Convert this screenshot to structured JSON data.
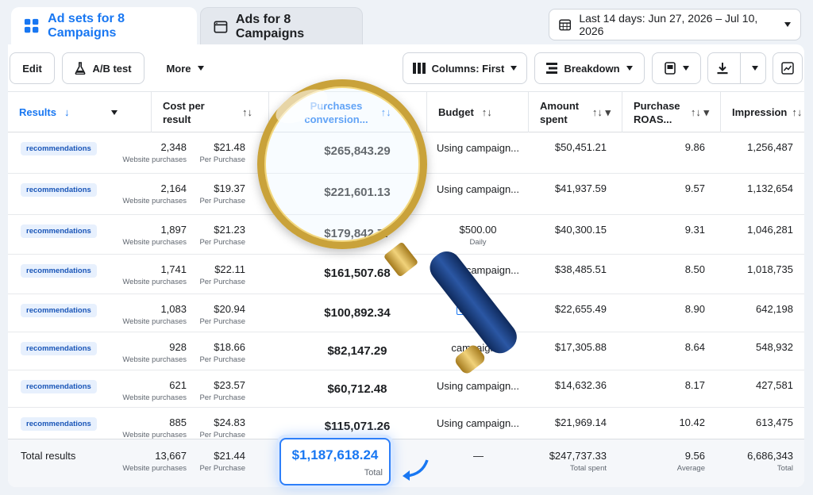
{
  "tabs": {
    "adsets": "Ad sets for 8 Campaigns",
    "ads": "Ads for 8 Campaigns"
  },
  "date_range": "Last 14 days: Jun 27, 2026 – Jul 10, 2026",
  "toolbar": {
    "edit": "Edit",
    "ab_test": "A/B test",
    "more": "More",
    "columns": "Columns: First",
    "breakdown": "Breakdown"
  },
  "columns": {
    "results": "Results",
    "cost_line1": "Cost per",
    "cost_line2": "result",
    "purch_line1": "Purchases",
    "purch_line2": "conversion...",
    "budget": "Budget",
    "amount_line1": "Amount",
    "amount_line2": "spent",
    "roas_line1": "Purchase",
    "roas_line2": "ROAS...",
    "impressions": "Impression"
  },
  "rows": [
    {
      "badge": "recommendations",
      "results": "2,348",
      "results_sub": "Website purchases",
      "cost": "$21.48",
      "cost_sub": "Per Purchase",
      "purchases": "$265,843.29",
      "budget": "Using campaign...",
      "budget_sub": "",
      "amount": "$50,451.21",
      "roas": "9.86",
      "impressions": "1,256,487"
    },
    {
      "badge": "recommendations",
      "results": "2,164",
      "results_sub": "Website purchases",
      "cost": "$19.37",
      "cost_sub": "Per Purchase",
      "purchases": "$221,601.13",
      "budget": "Using campaign...",
      "budget_sub": "",
      "amount": "$41,937.59",
      "roas": "9.57",
      "impressions": "1,132,654"
    },
    {
      "badge": "recommendations",
      "results": "1,897",
      "results_sub": "Website purchases",
      "cost": "$21.23",
      "cost_sub": "Per Purchase",
      "purchases": "$179,842.77",
      "budget": "$500.00",
      "budget_sub": "Daily",
      "amount": "$40,300.15",
      "roas": "9.31",
      "impressions": "1,046,281"
    },
    {
      "badge": "recommendations",
      "results": "1,741",
      "results_sub": "Website purchases",
      "cost": "$22.11",
      "cost_sub": "Per Purchase",
      "purchases": "$161,507.68",
      "budget": "Using campaign...",
      "budget_sub": "",
      "amount": "$38,485.51",
      "roas": "8.50",
      "impressions": "1,018,735"
    },
    {
      "badge": "recommendations",
      "results": "1,083",
      "results_sub": "Website purchases",
      "cost": "$20.94",
      "cost_sub": "Per Purchase",
      "purchases": "$100,892.34",
      "budget": "$150.00",
      "budget_sub": "Daily",
      "amount": "$22,655.49",
      "roas": "8.90",
      "impressions": "642,198"
    },
    {
      "badge": "recommendations",
      "results": "928",
      "results_sub": "Website purchases",
      "cost": "$18.66",
      "cost_sub": "Per Purchase",
      "purchases": "$82,147.29",
      "budget": "campaign...",
      "budget_sub": "",
      "amount": "$17,305.88",
      "roas": "8.64",
      "impressions": "548,932"
    },
    {
      "badge": "recommendations",
      "results": "621",
      "results_sub": "Website purchases",
      "cost": "$23.57",
      "cost_sub": "Per Purchase",
      "purchases": "$60,712.48",
      "budget": "Using campaign...",
      "budget_sub": "",
      "amount": "$14,632.36",
      "roas": "8.17",
      "impressions": "427,581"
    },
    {
      "badge": "recommendations",
      "results": "885",
      "results_sub": "Website purchases",
      "cost": "$24.83",
      "cost_sub": "Per Purchase",
      "purchases": "$115,071.26",
      "budget": "Using campaign...",
      "budget_sub": "",
      "amount": "$21,969.14",
      "roas": "10.42",
      "impressions": "613,475"
    }
  ],
  "totals": {
    "label": "Total results",
    "results": "13,667",
    "results_sub": "Website purchases",
    "cost": "$21.44",
    "cost_sub": "Per Purchase",
    "purchases": "$1,187,618.24",
    "purchases_sub": "Total",
    "budget": "—",
    "amount": "$247,737.33",
    "amount_sub": "Total spent",
    "roas": "9.56",
    "roas_sub": "Average",
    "impressions": "6,686,343",
    "impressions_sub": "Total"
  },
  "colors": {
    "accent": "#1877f2",
    "badge_bg": "#e7f0fd",
    "gold": "#c9a23a",
    "handle": "#1b3d7a"
  }
}
